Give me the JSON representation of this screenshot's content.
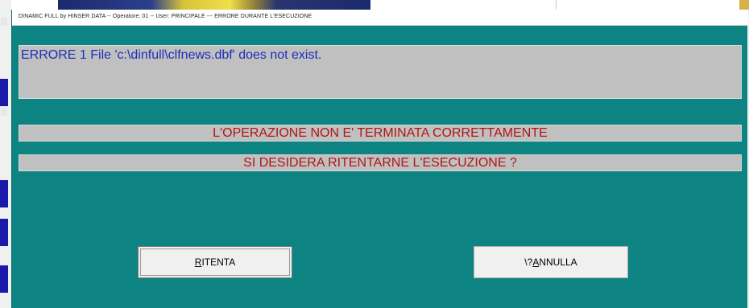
{
  "window": {
    "title": "DINAMIC FULL by HINSER DATA --  Operatore: 01 -- User: PRINCIPALE --- ERRORE DURANTE L'ESECUZIONE"
  },
  "error": {
    "message": "ERRORE 1 File 'c:\\dinfull\\clfnews.dbf' does not exist."
  },
  "messages": {
    "line1": "L'OPERAZIONE NON E' TERMINATA CORRETTAMENTE",
    "line2": "SI DESIDERA RITENTARNE L'ESECUZIONE ?"
  },
  "buttons": {
    "retry": {
      "accel": "R",
      "rest": "ITENTA"
    },
    "cancel": {
      "prefix": "\\?",
      "accel": "A",
      "rest": "NNULLA"
    }
  },
  "colors": {
    "dialog_background": "#0d8382",
    "panel_background": "#c0c0c0",
    "error_text": "#1c2fb8",
    "message_text": "#b01515"
  }
}
